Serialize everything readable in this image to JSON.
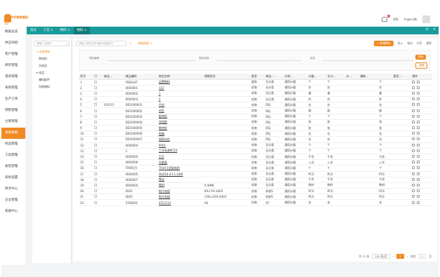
{
  "app": {
    "logo_text": "中科数联集团",
    "logo_sub": "易创"
  },
  "topbar": {
    "messages": "消息",
    "badge": "2",
    "user": "huge小枫"
  },
  "nav": [
    "数据总览",
    "供应商档",
    "客户管理",
    "库存管理",
    "电商管理",
    "采购管理",
    "生产订单",
    "销售管理",
    "仓库管理",
    "基础数据",
    "商品管理",
    "工具管理",
    "质检管理",
    "系统设置",
    "财务中心",
    "企业管理",
    "帮助中心"
  ],
  "nav_active": 9,
  "tabs": [
    {
      "label": "首页",
      "active": false
    },
    {
      "label": "工艺 ×",
      "active": false
    },
    {
      "label": "物料 ×",
      "active": false
    },
    {
      "label": "物料 ×",
      "active": true
    }
  ],
  "tree": {
    "search_placeholder": "请输入关键字",
    "nodes": [
      {
        "label": "▾ 全部物料",
        "cls": "root"
      },
      {
        "label": "原材料",
        "cls": "l2"
      },
      {
        "label": "半成品",
        "cls": "l2"
      },
      {
        "label": "▸ 成品",
        "cls": "l1"
      },
      {
        "label": "辅料配件",
        "cls": "l2"
      },
      {
        "label": "包装物料",
        "cls": "l2"
      }
    ]
  },
  "main": {
    "search_placeholder": "请输入物料名称/编码/规格型号",
    "search_icon": "search-icon",
    "advanced": "高级搜索 ∧",
    "toolbar": {
      "add": "+ 新增物料",
      "import": "导入",
      "export": "导出",
      "print": "打印",
      "more": "更多"
    },
    "filter": {
      "code_label": "物料编码",
      "name_label": "物料名称",
      "status_label": "状态",
      "search_btn": "搜索",
      "reset_btn": "重置"
    }
  },
  "table": {
    "columns": [
      "序号",
      "",
      "商品...",
      "商品编码",
      "商品名称",
      "规格型号",
      "",
      "类型",
      "商品...",
      "计划...",
      "计量...",
      "主计...",
      "计...",
      "辅助...",
      "",
      "是否...",
      "操作"
    ],
    "rows": [
      [
        "1",
        "",
        "",
        "FREIGHT",
        "运费物料",
        "",
        "",
        "虚拟",
        "无分类",
        "通用计量",
        "个",
        "个",
        "",
        "",
        "个",
        "",
        ""
      ],
      [
        "2",
        "",
        "",
        "0000001",
        "122",
        "",
        "",
        "实物",
        "无分类",
        "通用计量",
        "台",
        "台",
        "",
        "",
        "台",
        "",
        ""
      ],
      [
        "3",
        "",
        "",
        "0000002",
        "1",
        "",
        "",
        "实物",
        "无分类",
        "通用计量",
        "盒",
        "盒",
        "",
        "",
        "盒",
        "",
        ""
      ],
      [
        "4",
        "",
        "",
        "0000003",
        "2",
        "",
        "",
        "实物",
        "无分类",
        "通用计量",
        "件",
        "件",
        "",
        "",
        "件",
        "",
        ""
      ],
      [
        "5",
        "",
        "S197/3",
        "DD1000001",
        "手机",
        "",
        "",
        "实物",
        "DSJ",
        "通用计量",
        "台",
        "台",
        "",
        "",
        "台",
        "",
        ""
      ],
      [
        "6",
        "",
        "",
        "DD1000002",
        "ai机",
        "",
        "",
        "实物",
        "DSJ",
        "通用计量",
        "副",
        "副",
        "",
        "",
        "副",
        "",
        ""
      ],
      [
        "7",
        "",
        "",
        "DD1000003",
        "配电柜",
        "",
        "",
        "实物",
        "DSJ",
        "通用计量",
        "个",
        "个",
        "",
        "",
        "个",
        "",
        ""
      ],
      [
        "8",
        "",
        "",
        "DD1000004",
        "充电桩",
        "",
        "",
        "实物",
        "DSJ",
        "通用计量",
        "张",
        "张",
        "",
        "",
        "张",
        "",
        ""
      ],
      [
        "9",
        "",
        "",
        "DD1000005",
        "数控柜",
        "",
        "",
        "实物",
        "DSJ",
        "通用计量",
        "张",
        "张",
        "",
        "",
        "张",
        "",
        ""
      ],
      [
        "10",
        "",
        "",
        "DD1000006",
        "电箱",
        "",
        "",
        "实物",
        "DSJ",
        "通用计量",
        "台",
        "台",
        "",
        "",
        "台",
        "",
        ""
      ],
      [
        "11",
        "",
        "",
        "DD1000007",
        "国网台柜",
        "",
        "",
        "实物",
        "DSJ",
        "通用计量",
        "台",
        "台",
        "",
        "",
        "台",
        "",
        ""
      ],
      [
        "12",
        "",
        "",
        "0000004",
        "9001",
        "",
        "",
        "实物",
        "无分类",
        "通用计量",
        "个",
        "个",
        "",
        "",
        "个",
        "",
        ""
      ],
      [
        "13",
        "",
        "",
        "1",
        "工业电源KC10",
        "",
        "",
        "实物",
        "无分类",
        "通用计量",
        "个",
        "个",
        "",
        "",
        "个",
        "",
        ""
      ],
      [
        "14",
        "",
        "",
        "0000005",
        "222",
        "",
        "",
        "实物",
        "无分类",
        "通用计量",
        "千克",
        "千克",
        "",
        "",
        "千克",
        "",
        ""
      ],
      [
        "15",
        "",
        "",
        "0000006",
        "设备盖",
        "",
        "",
        "实物",
        "无分类",
        "通用计量",
        "入次",
        "入次",
        "",
        "",
        "入次",
        "",
        ""
      ],
      [
        "16",
        "",
        "",
        "T0001目",
        "T030-1型配电柜",
        "",
        "",
        "实物",
        "无分类",
        "通用计量",
        "个",
        "个",
        "",
        "",
        "个",
        "",
        ""
      ],
      [
        "17",
        "",
        "",
        "0000005",
        "DLD10-23-1,10W",
        "",
        "",
        "实物",
        "无分类",
        "通用计量",
        "PCS",
        "PCS",
        "",
        "",
        "PCS",
        "",
        ""
      ],
      [
        "18",
        "",
        "",
        "0000007",
        "铁丝",
        "",
        "",
        "实物",
        "无分类",
        "通用计量",
        "千克",
        "千克",
        "",
        "",
        "千克",
        "",
        ""
      ],
      [
        "19",
        "",
        "",
        "0000005",
        "铁材",
        "0.5MM",
        "",
        "实物",
        "无分类",
        "通用计量",
        "铁材",
        "铁材",
        "",
        "",
        "铁材",
        "",
        ""
      ],
      [
        "20",
        "",
        "",
        "0001",
        "贴片电容",
        "0R+5% 0402",
        "",
        "实物",
        "系统5",
        "通用计量",
        "PCS",
        "PCS",
        "",
        "",
        "PCS",
        "",
        ""
      ],
      [
        "21",
        "",
        "",
        "0002",
        "贴片电阻",
        "10K±10% 0402",
        "",
        "实物",
        "系统5",
        "通用计量",
        "PCS",
        "PCS",
        "",
        "",
        "PCS",
        "",
        ""
      ],
      [
        "22",
        "",
        "",
        "ST00001",
        "STL2112",
        "A0",
        "",
        "实物",
        "ST",
        "通用计量",
        "支",
        "支",
        "",
        "",
        "支",
        "",
        ""
      ]
    ]
  },
  "pager": {
    "total": "共 22 条",
    "size": "100 条/页",
    "prev": "‹",
    "page": "1",
    "next": "›",
    "goto": "前往",
    "page_input": "1",
    "page_unit": "页"
  }
}
